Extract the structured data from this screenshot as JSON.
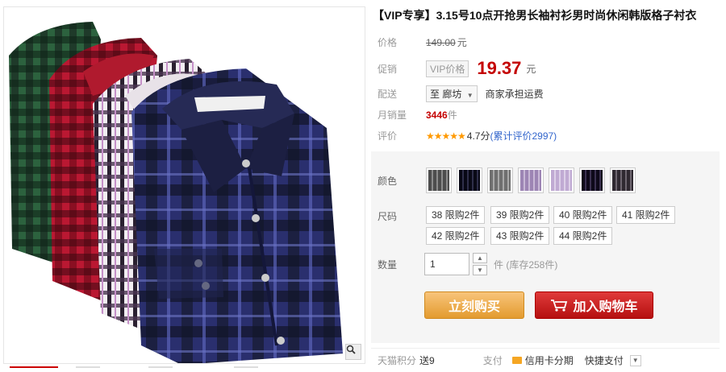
{
  "product": {
    "title": "【VIP专享】3.15号10点开抢男长袖衬衫男时尚休闲韩版格子衬衣"
  },
  "price": {
    "label": "价格",
    "original": "149.00",
    "unit": "元"
  },
  "promo": {
    "label": "促销",
    "tag": "VIP价格",
    "price": "19.37",
    "unit": "元"
  },
  "shipping": {
    "label": "配送",
    "destination": "至 廊坊",
    "note": "商家承担运费"
  },
  "monthly_sales": {
    "label": "月销量",
    "count": "3446",
    "unit": "件"
  },
  "reviews": {
    "label": "评价",
    "stars": "★★★★★",
    "score": "4.7分",
    "link": "(累计评价2997)"
  },
  "color": {
    "label": "颜色",
    "swatches": [
      {
        "name": "gray-check",
        "color": "#8c8c8c"
      },
      {
        "name": "navy-check",
        "color": "#2f2f4a"
      },
      {
        "name": "gray-white-check",
        "color": "#a8a8a8"
      },
      {
        "name": "lilac-check",
        "color": "#c8b8d6"
      },
      {
        "name": "light-purple-check",
        "color": "#ddd0e8"
      },
      {
        "name": "dark-purple-check",
        "color": "#3b3150"
      },
      {
        "name": "charcoal-check",
        "color": "#6e6670"
      }
    ]
  },
  "size": {
    "label": "尺码",
    "options": [
      "38 限购2件",
      "39 限购2件",
      "40 限购2件",
      "41 限购2件",
      "42 限购2件",
      "43 限购2件",
      "44 限购2件"
    ]
  },
  "quantity": {
    "label": "数量",
    "value": "1",
    "stock": "件 (库存258件)"
  },
  "actions": {
    "buy_now": "立刻购买",
    "add_to_cart": "加入购物车"
  },
  "footer": {
    "points_label": "天猫积分",
    "points_value": "送9",
    "pay_label": "支付",
    "credit_card": "信用卡分期",
    "quick_pay": "快捷支付"
  },
  "colors": {
    "accent_red": "#c40000",
    "buy_orange": "#e39b2f",
    "cart_red": "#b51010"
  }
}
